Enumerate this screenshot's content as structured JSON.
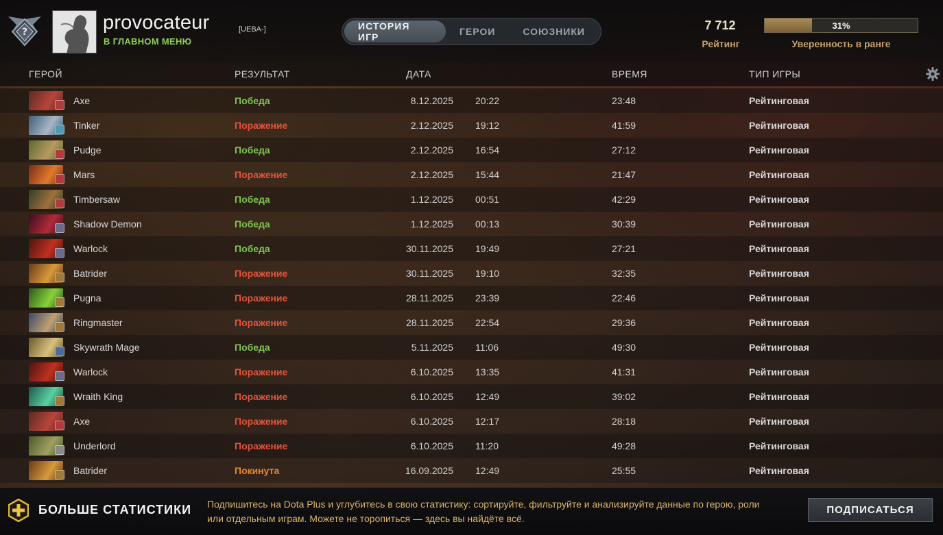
{
  "profile": {
    "name": "provocateur",
    "tag": "[UEBA-]",
    "status": "В ГЛАВНОМ МЕНЮ"
  },
  "tabs": [
    {
      "label": "ИСТОРИЯ ИГР",
      "active": true
    },
    {
      "label": "ГЕРОИ",
      "active": false
    },
    {
      "label": "СОЮЗНИКИ",
      "active": false
    }
  ],
  "rating": {
    "value": "7 712",
    "label": "Рейтинг"
  },
  "confidence": {
    "percent": 31,
    "text": "31%",
    "label": "Уверенность в ранге"
  },
  "columns": {
    "hero": "ГЕРОЙ",
    "result": "РЕЗУЛЬТАТ",
    "date": "ДАТА",
    "duration": "ВРЕМЯ",
    "type": "ТИП ИГРЫ"
  },
  "matches": [
    {
      "hero": "Axe",
      "result": "Победа",
      "kind": "win",
      "date": "8.12.2025",
      "time": "20:22",
      "duration": "23:48",
      "type": "Рейтинговая",
      "portrait": [
        "#5a2b22",
        "#b8443a"
      ],
      "badge": "#b33a3a"
    },
    {
      "hero": "Tinker",
      "result": "Поражение",
      "kind": "loss",
      "date": "2.12.2025",
      "time": "19:12",
      "duration": "41:59",
      "type": "Рейтинговая",
      "portrait": [
        "#3d5f7a",
        "#a9b6c6"
      ],
      "badge": "#4c9bb0"
    },
    {
      "hero": "Pudge",
      "result": "Победа",
      "kind": "win",
      "date": "2.12.2025",
      "time": "16:54",
      "duration": "27:12",
      "type": "Рейтинговая",
      "portrait": [
        "#5b6a2e",
        "#b79a62"
      ],
      "badge": "#b33a3a"
    },
    {
      "hero": "Mars",
      "result": "Поражение",
      "kind": "loss",
      "date": "2.12.2025",
      "time": "15:44",
      "duration": "21:47",
      "type": "Рейтинговая",
      "portrait": [
        "#7a2a1a",
        "#e07a2a"
      ],
      "badge": "#b33a3a"
    },
    {
      "hero": "Timbersaw",
      "result": "Победа",
      "kind": "win",
      "date": "1.12.2025",
      "time": "00:51",
      "duration": "42:29",
      "type": "Рейтинговая",
      "portrait": [
        "#2e3f2a",
        "#a0703a"
      ],
      "badge": "#b33a3a"
    },
    {
      "hero": "Shadow Demon",
      "result": "Победа",
      "kind": "win",
      "date": "1.12.2025",
      "time": "00:13",
      "duration": "30:39",
      "type": "Рейтинговая",
      "portrait": [
        "#3a0f1a",
        "#b02a3a"
      ],
      "badge": "#6a6a8a"
    },
    {
      "hero": "Warlock",
      "result": "Победа",
      "kind": "win",
      "date": "30.11.2025",
      "time": "19:49",
      "duration": "27:21",
      "type": "Рейтинговая",
      "portrait": [
        "#4a1410",
        "#c0301e"
      ],
      "badge": "#6a6a8a"
    },
    {
      "hero": "Batrider",
      "result": "Поражение",
      "kind": "loss",
      "date": "30.11.2025",
      "time": "19:10",
      "duration": "32:35",
      "type": "Рейтинговая",
      "portrait": [
        "#6a3a1a",
        "#d89a3a"
      ],
      "badge": "#a07a3a"
    },
    {
      "hero": "Pugna",
      "result": "Поражение",
      "kind": "loss",
      "date": "28.11.2025",
      "time": "23:39",
      "duration": "22:46",
      "type": "Рейтинговая",
      "portrait": [
        "#2a5a1a",
        "#8ad03a"
      ],
      "badge": "#a07a3a"
    },
    {
      "hero": "Ringmaster",
      "result": "Поражение",
      "kind": "loss",
      "date": "28.11.2025",
      "time": "22:54",
      "duration": "29:36",
      "type": "Рейтинговая",
      "portrait": [
        "#3a4a6a",
        "#c0a070"
      ],
      "badge": "#a07a3a"
    },
    {
      "hero": "Skywrath Mage",
      "result": "Победа",
      "kind": "win",
      "date": "5.11.2025",
      "time": "11:06",
      "duration": "49:30",
      "type": "Рейтинговая",
      "portrait": [
        "#6a5a2a",
        "#d8c080"
      ],
      "badge": "#4a6aa0"
    },
    {
      "hero": "Warlock",
      "result": "Поражение",
      "kind": "loss",
      "date": "6.10.2025",
      "time": "13:35",
      "duration": "41:31",
      "type": "Рейтинговая",
      "portrait": [
        "#4a1410",
        "#c0301e"
      ],
      "badge": "#6a6a8a"
    },
    {
      "hero": "Wraith King",
      "result": "Поражение",
      "kind": "loss",
      "date": "6.10.2025",
      "time": "12:49",
      "duration": "39:02",
      "type": "Рейтинговая",
      "portrait": [
        "#1a5a4a",
        "#5ad0a0"
      ],
      "badge": "#a07a3a"
    },
    {
      "hero": "Axe",
      "result": "Поражение",
      "kind": "loss",
      "date": "6.10.2025",
      "time": "12:17",
      "duration": "28:18",
      "type": "Рейтинговая",
      "portrait": [
        "#5a2b22",
        "#b8443a"
      ],
      "badge": "#b33a3a"
    },
    {
      "hero": "Underlord",
      "result": "Поражение",
      "kind": "loss",
      "date": "6.10.2025",
      "time": "11:20",
      "duration": "49:28",
      "type": "Рейтинговая",
      "portrait": [
        "#4a5a2a",
        "#a0a060"
      ],
      "badge": "#8a8a8a"
    },
    {
      "hero": "Batrider",
      "result": "Покинута",
      "kind": "abandon",
      "date": "16.09.2025",
      "time": "12:49",
      "duration": "25:55",
      "type": "Рейтинговая",
      "portrait": [
        "#6a3a1a",
        "#d89a3a"
      ],
      "badge": "#a07a3a"
    }
  ],
  "promo": {
    "title": "БОЛЬШЕ СТАТИСТИКИ",
    "text": "Подпишитесь на Dota Plus и углубитесь в свою статистику: сортируйте, фильтруйте и анализируйте данные по герою, роли или отдельным играм. Можете не торопиться — здесь вы найдёте всё.",
    "button": "ПОДПИСАТЬСЯ"
  },
  "colors": {
    "win": "#7fc552",
    "loss": "#e5533b",
    "abandon": "#e8862d",
    "gold": "#c7a36a"
  },
  "icons": {
    "rank": "rank-emblem-icon",
    "settings": "gear-icon",
    "dota_plus": "dota-plus-icon"
  }
}
